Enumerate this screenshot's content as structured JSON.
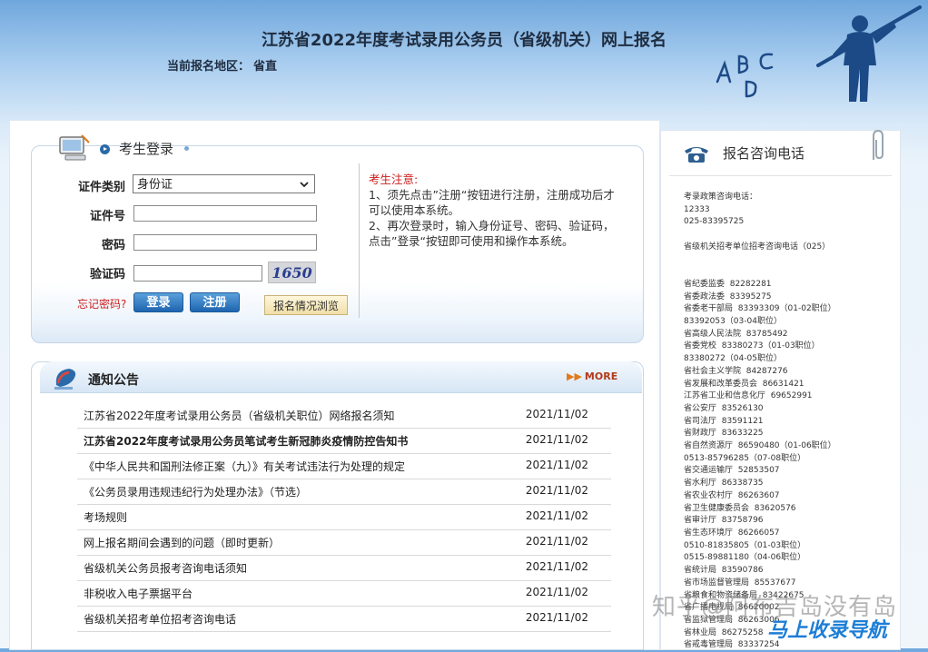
{
  "header": {
    "title": "江苏省2022年度考试录用公务员（省级机关）网上报名",
    "region_label": "当前报名地区：",
    "region_value": "省直",
    "deco_letters": [
      "A",
      "B",
      "C",
      "D"
    ]
  },
  "login": {
    "title": "考生登录",
    "id_type_label": "证件类别",
    "id_type_value": "身份证",
    "id_number_label": "证件号",
    "id_number_value": "",
    "password_label": "密码",
    "password_value": "",
    "captcha_label": "验证码",
    "captcha_value": "",
    "captcha_image_text": "1650",
    "forgot_password": "忘记密码?",
    "login_button": "登录",
    "register_button": "注册",
    "browse_button": "报名情况浏览",
    "notice_title": "考生注意:",
    "notice_1": "1、须先点击”注册“按钮进行注册，注册成功后才可以使用本系统。",
    "notice_2": "2、再次登录时，输入身份证号、密码、验证码，点击”登录“按钮即可使用和操作本系统。"
  },
  "news": {
    "title": "通知公告",
    "more": "MORE",
    "items": [
      {
        "title": "江苏省2022年度考试录用公务员（省级机关职位）网络报名须知",
        "date": "2021/11/02",
        "bold": false
      },
      {
        "title": "江苏省2022年度考试录用公务员笔试考生新冠肺炎疫情防控告知书",
        "date": "2021/11/02",
        "bold": true
      },
      {
        "title": "《中华人民共和国刑法修正案（九）》有关考试违法行为处理的规定",
        "date": "2021/11/02",
        "bold": false
      },
      {
        "title": "《公务员录用违规违纪行为处理办法》（节选）",
        "date": "2021/11/02",
        "bold": false
      },
      {
        "title": "考场规则",
        "date": "2021/11/02",
        "bold": false
      },
      {
        "title": "网上报名期间会遇到的问题（即时更新）",
        "date": "2021/11/02",
        "bold": false
      },
      {
        "title": "省级机关公务员报考咨询电话须知",
        "date": "2021/11/02",
        "bold": false
      },
      {
        "title": "非税收入电子票据平台",
        "date": "2021/11/02",
        "bold": false
      },
      {
        "title": "省级机关招考单位招考咨询电话",
        "date": "2021/11/02",
        "bold": false
      }
    ]
  },
  "consult": {
    "title": "报名咨询电话",
    "lines": [
      "考录政策咨询电话：",
      "12333",
      "025-83395725",
      "",
      "省级机关招考单位招考咨询电话（025）",
      "",
      "",
      "省纪委监委  82282281",
      "省委政法委  83395275",
      "省委老干部局  83393309（01-02职位）",
      "83392053（03-04职位）",
      "省高级人民法院  83785492",
      "省委党校  83380273（01-03职位）",
      "83380272（04-05职位）",
      "省社会主义学院  84287276",
      "省发展和改革委员会  86631421",
      "江苏省工业和信息化厅  69652991",
      "省公安厅  83526130",
      "省司法厅  83591121",
      "省财政厅  83633225",
      "省自然资源厅  86590480（01-06职位）",
      "0513-85796285（07-08职位）",
      "省交通运输厅  52853507",
      "省水利厅  86338735",
      "省农业农村厅  86263607",
      "省卫生健康委员会  83620576",
      "省审计厅  83758796",
      "省生态环境厅  86266057",
      "0510-81835805（01-03职位）",
      "0515-89881180（04-06职位）",
      "省统计局  83590786",
      "省市场监督管理局  85537677",
      "省粮食和物资储备局  83422675",
      "省广播电视局  86620002",
      "省监狱管理局  86263006",
      "省林业局  86275258",
      "省戒毒管理局  83337254"
    ]
  },
  "watermark": {
    "text": "知乎@阿布吉岛没有岛",
    "logo": "马上收录导航"
  },
  "colors": {
    "accent_blue": "#1e64ae",
    "notice_red": "#cc1f1f",
    "more_orange": "#b23a1a"
  }
}
